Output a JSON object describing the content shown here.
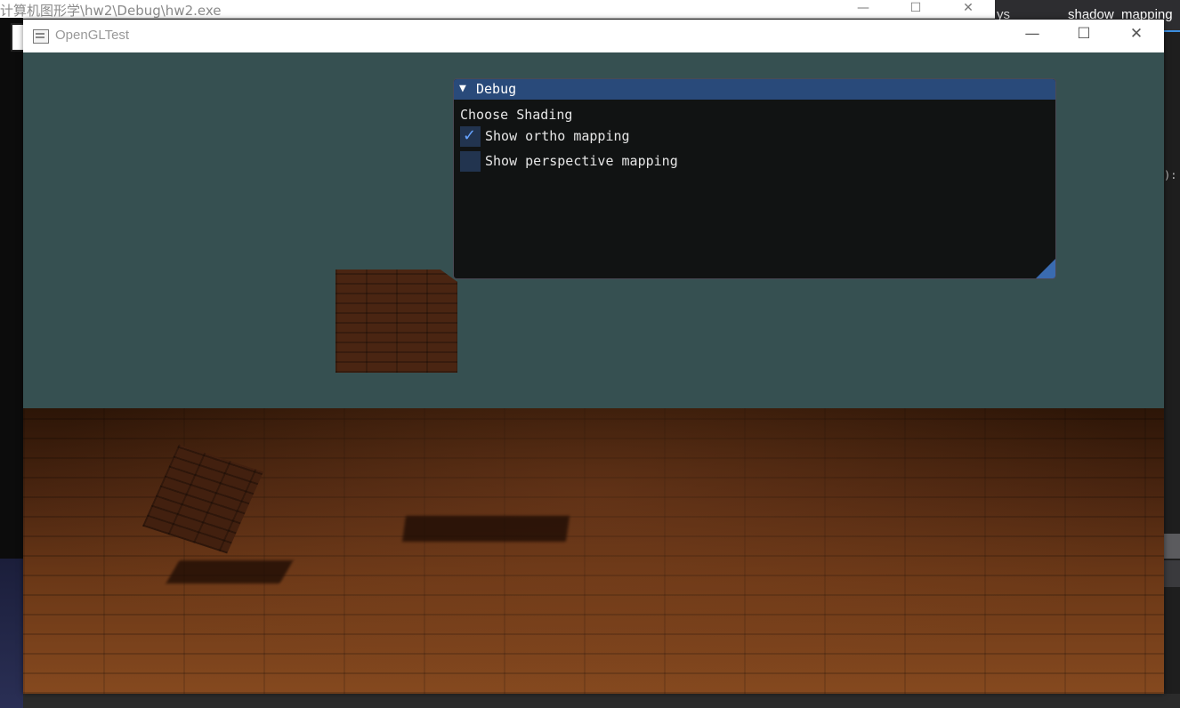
{
  "console_window": {
    "title": "计算机图形学\\hw2\\Debug\\hw2.exe",
    "controls": {
      "minimize": "—",
      "maximize": "☐",
      "close": "✕"
    }
  },
  "ide": {
    "tabs": [
      {
        "label": "ys"
      },
      {
        "label": "shadow_mapping"
      }
    ],
    "snippet": "):"
  },
  "gl_window": {
    "title": "OpenGLTest",
    "controls": {
      "minimize": "—",
      "maximize": "☐",
      "close": "✕"
    }
  },
  "debug_panel": {
    "title": "Debug",
    "collapse_arrow": "▼",
    "heading": "Choose Shading",
    "checkboxes": [
      {
        "label": "Show ortho mapping",
        "checked": true,
        "check_glyph": "✓"
      },
      {
        "label": "Show perspective mapping",
        "checked": false,
        "check_glyph": ""
      }
    ]
  },
  "colors": {
    "wall": "#365051",
    "imgui_title": "#294a7a",
    "checkbox_bg": "#22344f",
    "check_mark": "#66a3ff"
  }
}
